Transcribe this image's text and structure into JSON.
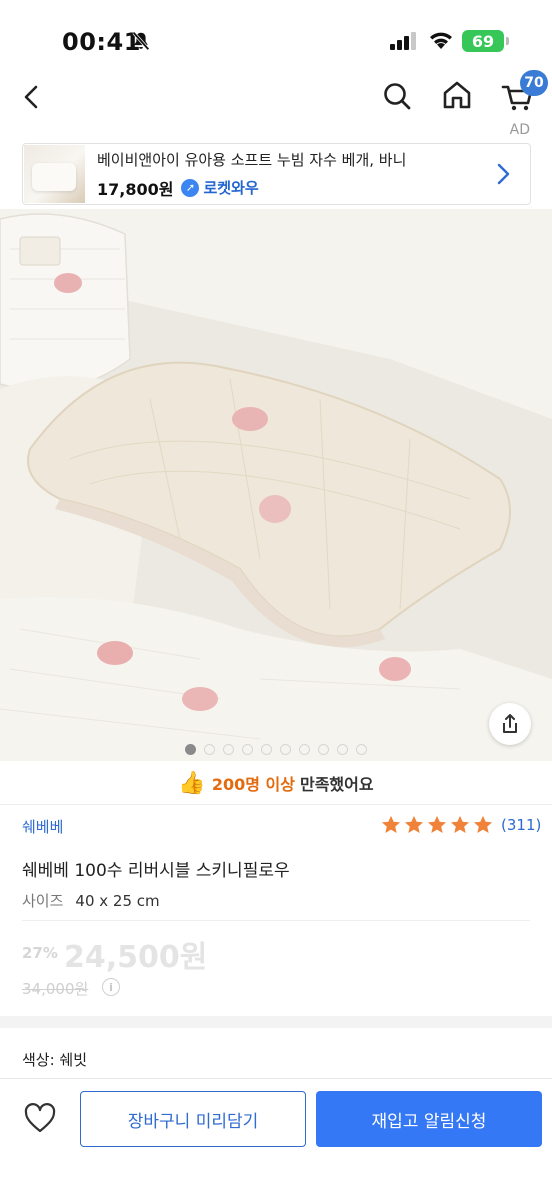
{
  "status_bar": {
    "time": "00:41",
    "battery": "69"
  },
  "nav": {
    "cart_count": "70",
    "ad_label": "AD"
  },
  "ad_banner": {
    "title": "베이비앤아이 유아용 소프트 누빔 자수 베개, 바니",
    "price": "17,800원",
    "rocket": "로켓와우"
  },
  "gallery": {
    "image_count": 10,
    "active_index": 0
  },
  "satisfaction": {
    "highlight": "200명 이상",
    "text": "만족했어요"
  },
  "product": {
    "brand": "쉐베베",
    "rating": 5,
    "reviews": "(311)",
    "name": "쉐베베 100수 리버시블 스키니필로우",
    "option_key": "사이즈",
    "option_value": "40 x 25 cm",
    "discount": "27%",
    "sale_price": "24,500원",
    "original_price": "34,000원"
  },
  "color_option": "색상: 쉐빗",
  "bottom_bar": {
    "cart_button": "장바구니 미리담기",
    "notify_button": "재입고 알림신청"
  },
  "colors": {
    "accent": "#3478f6",
    "link": "#2f6bd0",
    "star": "#f0833a",
    "highlight": "#e36b0e"
  }
}
